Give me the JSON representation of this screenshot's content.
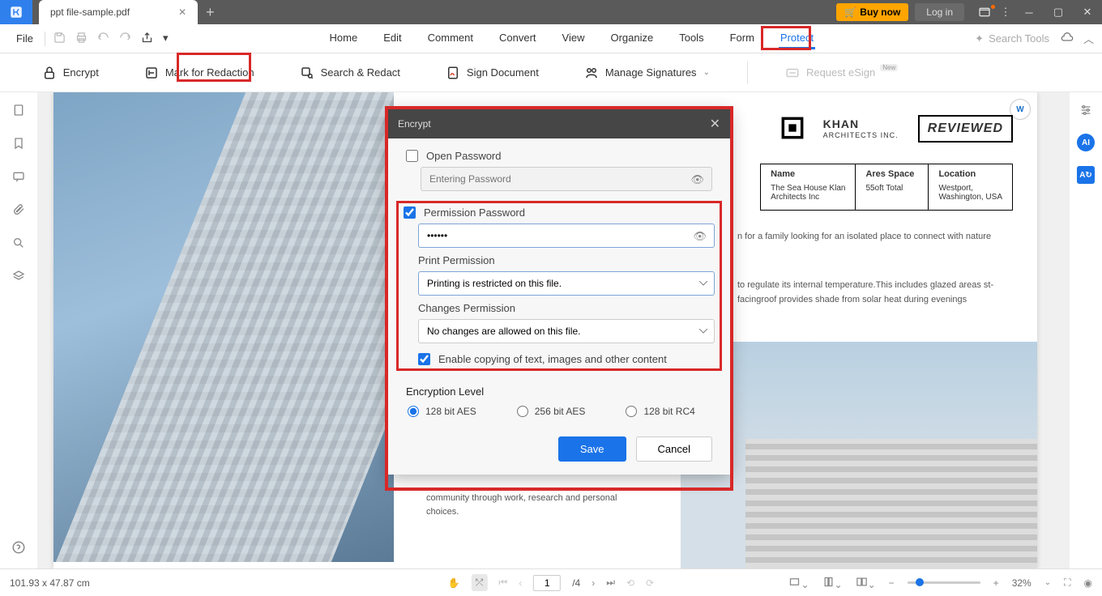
{
  "titlebar": {
    "tab_name": "ppt file-sample.pdf",
    "buy": "Buy now",
    "login": "Log in"
  },
  "menubar": {
    "file": "File",
    "tabs": [
      "Home",
      "Edit",
      "Comment",
      "Convert",
      "View",
      "Organize",
      "Tools",
      "Form",
      "Protect"
    ],
    "active_index": 8,
    "search_placeholder": "Search Tools"
  },
  "ribbon": {
    "encrypt": "Encrypt",
    "mark": "Mark for Redaction",
    "search_redact": "Search & Redact",
    "sign": "Sign Document",
    "manage_sig": "Manage Signatures",
    "request_esign": "Request eSign",
    "badge_new": "New"
  },
  "doc": {
    "khan": "KHAN",
    "khan_sub": "ARCHITECTS INC.",
    "reviewed": "REVIEWED",
    "info": {
      "h1": "Name",
      "v1a": "The Sea House Klan",
      "v1b": "Architects Inc",
      "h2": "Ares Space",
      "v2": "55oft Total",
      "h3": "Location",
      "v3a": "Westport,",
      "v3b": "Washington, USA"
    },
    "p1": "n for a family looking for an isolated place to connect with nature",
    "p2": "to regulate its internal temperature.This includes glazed areas st-facingroof provides shade from solar heat during evenings",
    "p3": "community through work, research and personal choices."
  },
  "dialog": {
    "title": "Encrypt",
    "open_pw": "Open Password",
    "open_pw_placeholder": "Entering Password",
    "perm_pw": "Permission Password",
    "perm_pw_value": "••••••",
    "print_label": "Print Permission",
    "print_value": "Printing is restricted on this file.",
    "changes_label": "Changes Permission",
    "changes_value": "No changes are allowed on this file.",
    "copy_label": "Enable copying of text, images and other content",
    "enc_level": "Encryption Level",
    "r1": "128 bit AES",
    "r2": "256 bit AES",
    "r3": "128 bit RC4",
    "save": "Save",
    "cancel": "Cancel"
  },
  "status": {
    "dims": "101.93 x 47.87 cm",
    "page_cur": "1",
    "page_total": "/4",
    "zoom": "32%"
  }
}
